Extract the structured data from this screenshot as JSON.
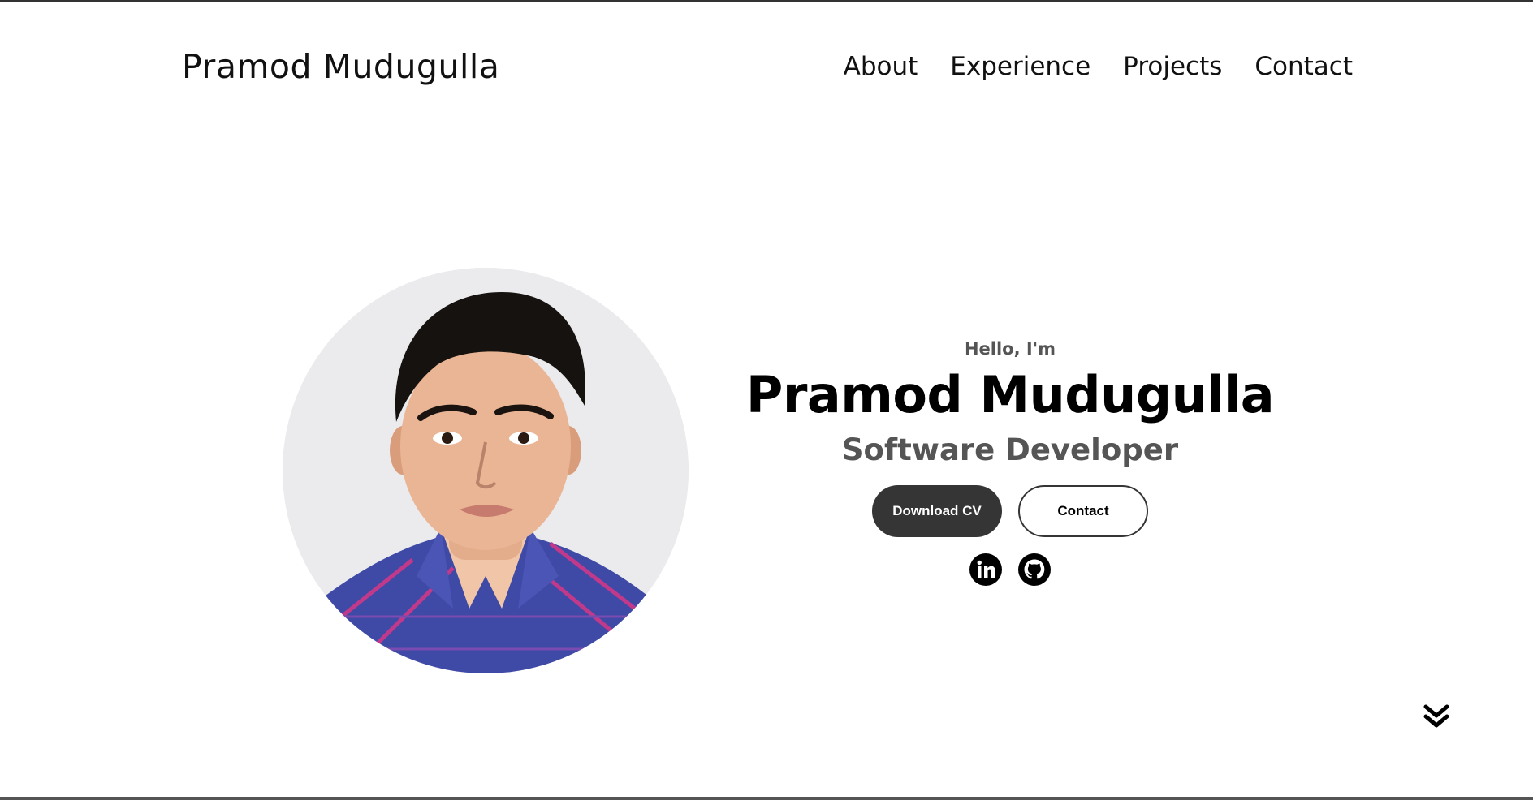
{
  "nav": {
    "logo": "Pramod Mudugulla",
    "links": [
      "About",
      "Experience",
      "Projects",
      "Contact"
    ]
  },
  "profile": {
    "photo_icon": "profile-photo"
  },
  "hero": {
    "greeting": "Hello, I'm",
    "name": "Pramod Mudugulla",
    "role": "Software Developer",
    "buttons": {
      "download_cv": "Download CV",
      "contact": "Contact"
    },
    "socials": [
      "linkedin-icon",
      "github-icon"
    ]
  },
  "scroll_icon": "chevron-double-down-icon",
  "colors": {
    "dark_button": "#353535",
    "muted_text": "#555555",
    "text": "#000000"
  }
}
